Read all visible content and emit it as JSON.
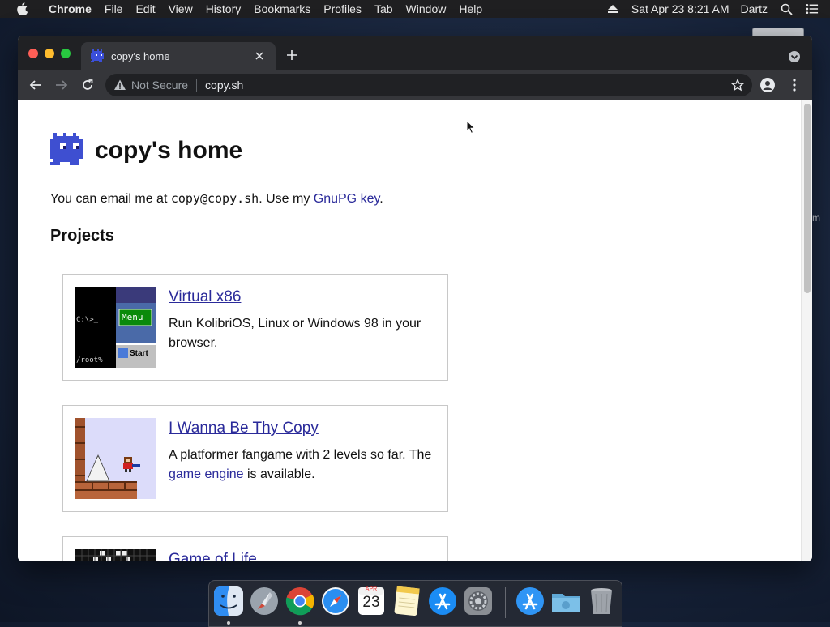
{
  "menubar": {
    "app": "Chrome",
    "items": [
      "File",
      "Edit",
      "View",
      "History",
      "Bookmarks",
      "Profiles",
      "Tab",
      "Window",
      "Help"
    ],
    "datetime": "Sat Apr 23  8:21 AM",
    "user": "Dartz"
  },
  "desktop": {
    "label_fragment": "m"
  },
  "browser": {
    "tab_title": "copy's home",
    "security_label": "Not Secure",
    "url": "copy.sh"
  },
  "page": {
    "title": "copy's home",
    "intro_prefix": "You can email me at ",
    "email": "copy@copy.sh",
    "intro_middle": ". Use my ",
    "gpg_link": "GnuPG key",
    "intro_suffix": ".",
    "projects_heading": "Projects",
    "projects": [
      {
        "title": "Virtual x86",
        "desc": "Run KolibriOS, Linux or Windows 98 in your browser.",
        "thumb": {
          "prompt": "C:\\>_",
          "menu": "Menu",
          "root": "/root%",
          "start": "Start"
        }
      },
      {
        "title": "I Wanna Be Thy Copy",
        "desc_before": "A platformer fangame with 2 levels so far. The ",
        "desc_link": "game engine",
        "desc_after": " is available."
      },
      {
        "title": "Game of Life"
      }
    ]
  },
  "dock": {
    "apps": [
      "finder-icon",
      "launchpad-icon",
      "chrome-icon",
      "safari-icon",
      "calendar-icon",
      "notes-icon",
      "app-store-icon",
      "system-preferences-icon",
      "app-store-download-icon",
      "downloads-folder-icon",
      "trash-icon"
    ],
    "calendar": {
      "month": "APR",
      "day": "23"
    }
  },
  "colors": {
    "link": "#2a2a9a",
    "tabstrip": "#202124",
    "toolbar": "#35363a"
  }
}
